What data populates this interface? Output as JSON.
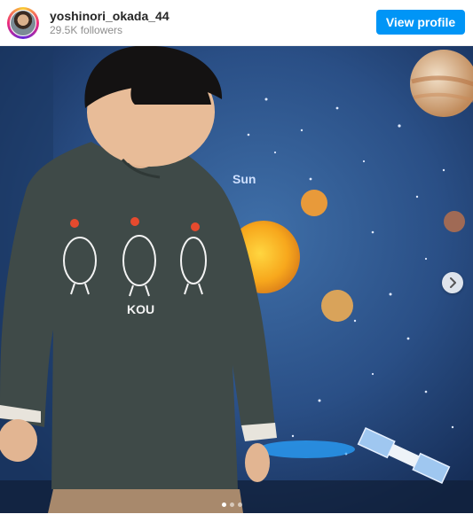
{
  "header": {
    "username": "yoshinori_okada_44",
    "followers": "29.5K followers",
    "view_profile_label": "View profile"
  },
  "post": {
    "shirt_text": "KOU",
    "poster_labels": [
      "Sun"
    ],
    "carousel": {
      "slide_count": 3,
      "active_index": 0
    }
  },
  "colors": {
    "accent": "#0095f6",
    "username": "#262626",
    "secondary_text": "#8e8e8e"
  },
  "icons": {
    "next": "chevron-right-icon"
  }
}
